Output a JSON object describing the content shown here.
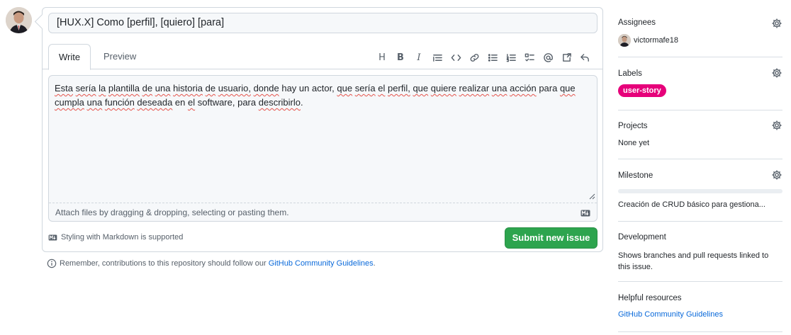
{
  "issue": {
    "title_value": "[HUX.X] Como [perfil], [quiero] [para]",
    "tabs": [
      {
        "label": "Write"
      },
      {
        "label": "Preview"
      }
    ],
    "toolbar": [
      {
        "icon": "heading-icon",
        "glyph": "H"
      },
      {
        "icon": "bold-icon",
        "glyph": "B"
      },
      {
        "icon": "italic-icon",
        "glyph": "I"
      },
      {
        "icon": "quote-icon"
      },
      {
        "icon": "code-icon"
      },
      {
        "icon": "link-icon"
      },
      {
        "icon": "unordered-list-icon"
      },
      {
        "icon": "ordered-list-icon"
      },
      {
        "icon": "task-list-icon"
      },
      {
        "icon": "mention-icon"
      },
      {
        "icon": "cross-reference-icon"
      },
      {
        "icon": "reply-icon"
      }
    ],
    "body_words": [
      {
        "t": "Esta",
        "s": true
      },
      {
        "t": " ",
        "s": false
      },
      {
        "t": "sería",
        "s": true
      },
      {
        "t": " ",
        "s": false
      },
      {
        "t": "la",
        "s": true
      },
      {
        "t": " ",
        "s": false
      },
      {
        "t": "plantilla",
        "s": true
      },
      {
        "t": " ",
        "s": false
      },
      {
        "t": "de",
        "s": true
      },
      {
        "t": " ",
        "s": false
      },
      {
        "t": "una",
        "s": true
      },
      {
        "t": " ",
        "s": false
      },
      {
        "t": "historia",
        "s": true
      },
      {
        "t": " ",
        "s": false
      },
      {
        "t": "de",
        "s": true
      },
      {
        "t": " ",
        "s": false
      },
      {
        "t": "usuario,",
        "s": true
      },
      {
        "t": " ",
        "s": false
      },
      {
        "t": "donde",
        "s": true
      },
      {
        "t": " hay un ",
        "s": false
      },
      {
        "t": "actor,",
        "s": false
      },
      {
        "t": " ",
        "s": false
      },
      {
        "t": "que",
        "s": true
      },
      {
        "t": " ",
        "s": false
      },
      {
        "t": "sería",
        "s": true
      },
      {
        "t": " ",
        "s": false
      },
      {
        "t": "el",
        "s": true
      },
      {
        "t": " ",
        "s": false
      },
      {
        "t": "perfil,",
        "s": true
      },
      {
        "t": " ",
        "s": false
      },
      {
        "t": "que",
        "s": true
      },
      {
        "t": " ",
        "s": false
      },
      {
        "t": "quiere",
        "s": true
      },
      {
        "t": " ",
        "s": false
      },
      {
        "t": "realizar",
        "s": true
      },
      {
        "t": " ",
        "s": false
      },
      {
        "t": "una",
        "s": true
      },
      {
        "t": " ",
        "s": false
      },
      {
        "t": "acción",
        "s": true
      },
      {
        "t": " para ",
        "s": false
      },
      {
        "t": "que",
        "s": true
      },
      {
        "t": " ",
        "s": false
      },
      {
        "t": "cumpla",
        "s": true
      },
      {
        "t": " ",
        "s": false
      },
      {
        "t": "una",
        "s": true
      },
      {
        "t": " ",
        "s": false
      },
      {
        "t": "función",
        "s": true
      },
      {
        "t": " ",
        "s": false
      },
      {
        "t": "deseada",
        "s": true
      },
      {
        "t": " en ",
        "s": false
      },
      {
        "t": "el",
        "s": true
      },
      {
        "t": " software, para ",
        "s": false
      },
      {
        "t": "describirlo",
        "s": true
      },
      {
        "t": ".",
        "s": false
      }
    ],
    "attach_hint": "Attach files by dragging & dropping, selecting or pasting them.",
    "markdown_note": "Styling with Markdown is supported",
    "submit_label": "Submit new issue",
    "reminder_prefix": "Remember, contributions to this repository should follow our ",
    "reminder_link": "GitHub Community Guidelines",
    "reminder_suffix": "."
  },
  "sidebar": {
    "assignees": {
      "heading": "Assignees",
      "user": "victormafe18"
    },
    "labels": {
      "heading": "Labels",
      "label": "user-story",
      "label_color": "#e6007a"
    },
    "projects": {
      "heading": "Projects",
      "value": "None yet"
    },
    "milestone": {
      "heading": "Milestone",
      "value": "Creación de CRUD básico para gestiona..."
    },
    "development": {
      "heading": "Development",
      "value": "Shows branches and pull requests linked to this issue."
    },
    "helpful": {
      "heading": "Helpful resources",
      "link": "GitHub Community Guidelines"
    }
  },
  "colors": {
    "accent_green": "#2da44e",
    "link_blue": "#0969da",
    "label_pink": "#e6007a"
  }
}
